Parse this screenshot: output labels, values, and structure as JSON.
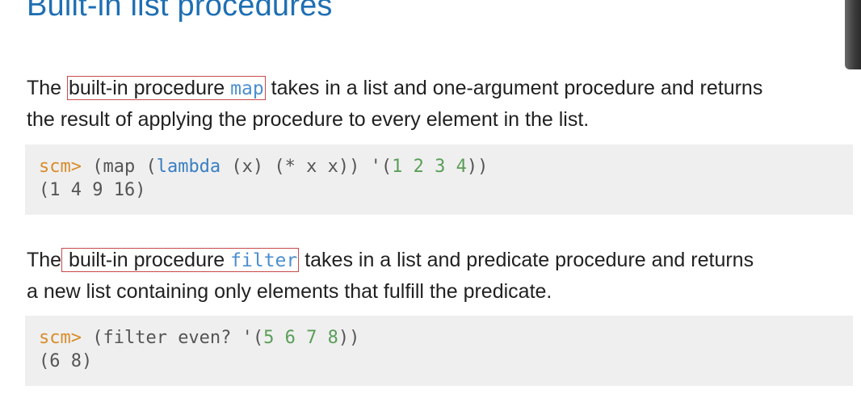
{
  "title": "Built-in list procedures",
  "section1": {
    "pre": "The ",
    "highlight_text": "built-in procedure ",
    "code_name": "map",
    "post": " takes in a list and one-argument procedure and returns",
    "line2": "the result of applying the procedure to every element in the list."
  },
  "code1": {
    "prompt": "scm>",
    "t1": " (map (",
    "kw": "lambda",
    "t2": " (x) (* x x)) '(",
    "n1": "1",
    "n2": "2",
    "n3": "3",
    "n4": "4",
    "t3": "))",
    "output": "(1 4 9 16)"
  },
  "section2": {
    "pre": "The",
    "highlight_text": " built-in procedure ",
    "code_name": "filter",
    "post": " takes in a list and predicate procedure and returns",
    "line2": "a new list containing only elements that fulfill the predicate."
  },
  "code2": {
    "prompt": "scm>",
    "t1": " (filter even? '(",
    "n1": "5",
    "n2": "6",
    "n3": "7",
    "n4": "8",
    "t2": "))",
    "output": "(6 8)"
  },
  "colors": {
    "title": "#1e6fb3",
    "highlight_box": "#c94a4a",
    "code_bg": "#efefef",
    "prompt": "#d98c2b",
    "keyword": "#3a7fc2",
    "number": "#5a9e58"
  }
}
